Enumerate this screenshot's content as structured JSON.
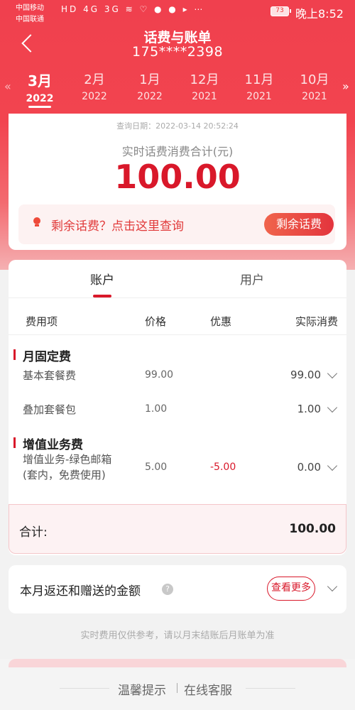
{
  "status_bar": {
    "carrier1": "中国移动",
    "carrier2": "中国联通",
    "icons": "HD 4G 3G ≋ ♡ ● ● ▸ ⋯",
    "battery": "73",
    "time": "晚上8:52"
  },
  "header": {
    "title": "话费与账单",
    "phone": "175****2398"
  },
  "months": [
    {
      "month": "3月",
      "year": "2022",
      "active": true
    },
    {
      "month": "2月",
      "year": "2022"
    },
    {
      "month": "1月",
      "year": "2022"
    },
    {
      "month": "12月",
      "year": "2021"
    },
    {
      "month": "11月",
      "year": "2021"
    },
    {
      "month": "10月",
      "year": "2021"
    }
  ],
  "summary": {
    "query_date": "查询日期：2022-03-14 20:52:24",
    "total_label": "实时话费消费合计(元)",
    "total_amount": "100.00",
    "balance_text": "剩余话费？点击这里查询",
    "balance_button": "剩余话费"
  },
  "tabs": [
    "账户",
    "用户"
  ],
  "table": {
    "headers": [
      "费用项",
      "价格",
      "优惠",
      "实际消费"
    ],
    "sections": [
      {
        "title": "月固定费",
        "rows": [
          {
            "name": "基本套餐费",
            "price": "99.00",
            "discount": "",
            "actual": "99.00"
          },
          {
            "name": "叠加套餐包",
            "price": "1.00",
            "discount": "",
            "actual": "1.00"
          }
        ]
      },
      {
        "title": "增值业务费",
        "rows": [
          {
            "name_line1": "增值业务-绿色邮箱",
            "name_line2": "(套内，免费使用)",
            "price": "5.00",
            "discount": "-5.00",
            "actual": "0.00"
          }
        ]
      }
    ],
    "total_label": "合计:",
    "total_value": "100.00"
  },
  "refund": {
    "title": "本月返还和赠送的金额",
    "help": "?",
    "more_button": "查看更多"
  },
  "disclaimer": "实时费用仅供参考，请以月末结账后月账单为准",
  "footer": {
    "tip": "温馨提示",
    "service": "在线客服"
  }
}
